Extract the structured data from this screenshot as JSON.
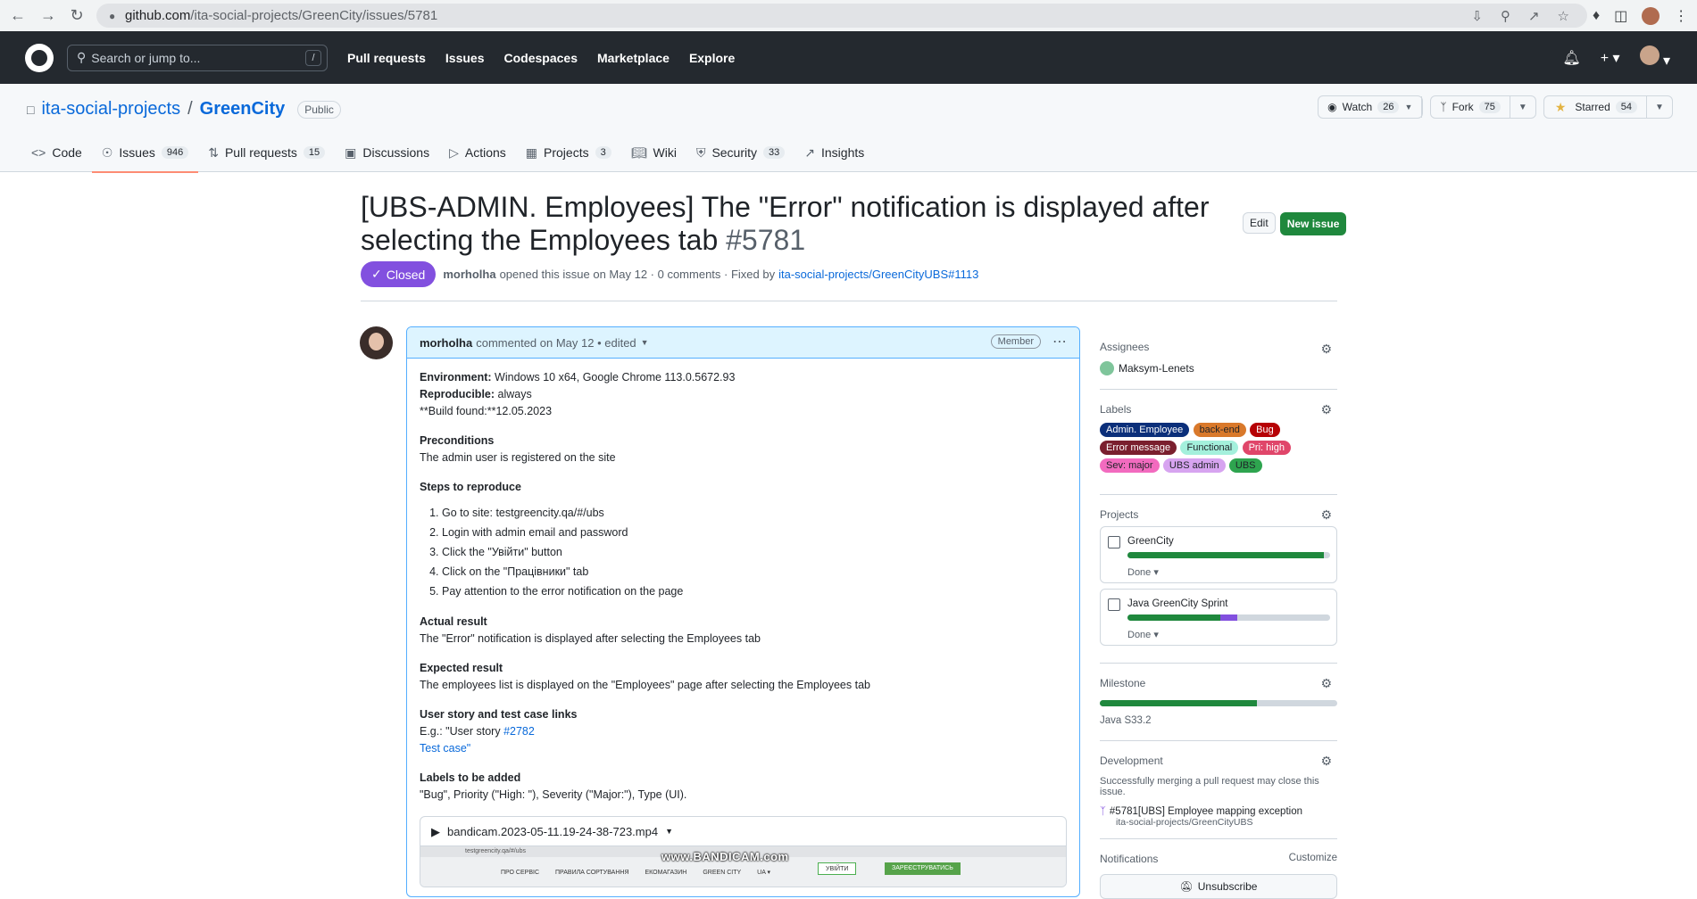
{
  "browser": {
    "url_host": "github.com",
    "url_path": "/ita-social-projects/GreenCity/issues/5781"
  },
  "header": {
    "search_placeholder": "Search or jump to...",
    "search_key": "/",
    "nav": [
      "Pull requests",
      "Issues",
      "Codespaces",
      "Marketplace",
      "Explore"
    ]
  },
  "repo": {
    "owner": "ita-social-projects",
    "separator": "/",
    "name": "GreenCity",
    "visibility": "Public",
    "watch_label": "Watch",
    "watch_count": "26",
    "fork_label": "Fork",
    "fork_count": "75",
    "star_label": "Starred",
    "star_count": "54",
    "tabs": [
      {
        "label": "Code",
        "count": ""
      },
      {
        "label": "Issues",
        "count": "946"
      },
      {
        "label": "Pull requests",
        "count": "15"
      },
      {
        "label": "Discussions",
        "count": ""
      },
      {
        "label": "Actions",
        "count": ""
      },
      {
        "label": "Projects",
        "count": "3"
      },
      {
        "label": "Wiki",
        "count": ""
      },
      {
        "label": "Security",
        "count": "33"
      },
      {
        "label": "Insights",
        "count": ""
      }
    ]
  },
  "issue": {
    "title": "[UBS-ADMIN. Employees] The \"Error\" notification is displayed after selecting the Employees tab",
    "number": "#5781",
    "edit_label": "Edit",
    "new_issue_label": "New issue",
    "state": "Closed",
    "author": "morholha",
    "meta_text": "opened this issue on May 12 · 0 comments · Fixed by",
    "fixed_by": "ita-social-projects/GreenCityUBS#1113"
  },
  "comment": {
    "author": "morholha",
    "meta": "commented on May 12 • edited",
    "badge": "Member",
    "env_label": "Environment:",
    "env_value": "Windows 10 x64, Google Chrome 113.0.5672.93",
    "repro_label": "Reproducible:",
    "repro_value": "always",
    "build_line": "**Build found:**12.05.2023",
    "preconditions_title": "Preconditions",
    "preconditions_text": "The admin user is registered on the site",
    "steps_title": "Steps to reproduce",
    "steps": [
      "Go to site: testgreencity.qa/#/ubs",
      "Login with admin email and password",
      "Click the \"Увійти\" button",
      "Click on the \"Працівники\" tab",
      "Pay attention to the error notification on the page"
    ],
    "actual_title": "Actual result",
    "actual_text": "The \"Error\" notification is displayed after selecting the Employees tab",
    "expected_title": "Expected result",
    "expected_text": "The employees list is displayed on the \"Employees\" page after selecting the Employees tab",
    "story_title": "User story and test case links",
    "story_prefix": "E.g.: \"User story",
    "story_link": "#2782",
    "test_case": "Test case\"",
    "labels_title": "Labels to be added",
    "labels_text": "\"Bug\", Priority (\"High: \"), Severity (\"Major:\"), Type (UI).",
    "video_name": "bandicam.2023-05-11.19-24-38-723.mp4",
    "video_url": "testgreencity.qa/#/ubs",
    "video_nav": [
      "ПРО СЕРВІС",
      "ПРАВИЛА СОРТУВАННЯ",
      "ЕКОМАГАЗИН",
      "GREEN CITY",
      "UA ▾"
    ],
    "video_login": "УВІЙТИ",
    "video_register": "ЗАРЕЄСТРУВАТИСЬ",
    "watermark": "www.BANDICAM.com"
  },
  "sidebar": {
    "assignees_title": "Assignees",
    "assignee": "Maksym-Lenets",
    "labels_title": "Labels",
    "labels": [
      {
        "name": "Admin. Employee",
        "bg": "#0b2f7a",
        "fg": "#ffffff"
      },
      {
        "name": "back-end",
        "bg": "#d9792b",
        "fg": "#1f2328"
      },
      {
        "name": "Bug",
        "bg": "#b60205",
        "fg": "#ffffff"
      },
      {
        "name": "Error message",
        "bg": "#7a1f2e",
        "fg": "#ffffff"
      },
      {
        "name": "Functional",
        "bg": "#a4f0dc",
        "fg": "#1f2328"
      },
      {
        "name": "Pri: high",
        "bg": "#e0466a",
        "fg": "#ffffff"
      },
      {
        "name": "Sev: major",
        "bg": "#f26bbf",
        "fg": "#1f2328"
      },
      {
        "name": "UBS admin",
        "bg": "#d7a4f0",
        "fg": "#1f2328"
      },
      {
        "name": "UBS",
        "bg": "#2ea44f",
        "fg": "#1f2328"
      }
    ],
    "projects_title": "Projects",
    "projects": [
      {
        "name": "GreenCity",
        "status": "Done ▾",
        "done": 0.97,
        "in_progress": 0
      },
      {
        "name": "Java GreenCity Sprint",
        "status": "Done ▾",
        "done": 0.46,
        "in_progress": 0.08
      }
    ],
    "milestone_title": "Milestone",
    "milestone_progress": 0.66,
    "milestone_name": "Java S33.2",
    "development_title": "Development",
    "development_text": "Successfully merging a pull request may close this issue.",
    "pr_title": "#5781[UBS] Employee mapping exception",
    "pr_repo": "ita-social-projects/GreenCityUBS",
    "notifications_title": "Notifications",
    "customize": "Customize",
    "unsubscribe": "Unsubscribe"
  }
}
